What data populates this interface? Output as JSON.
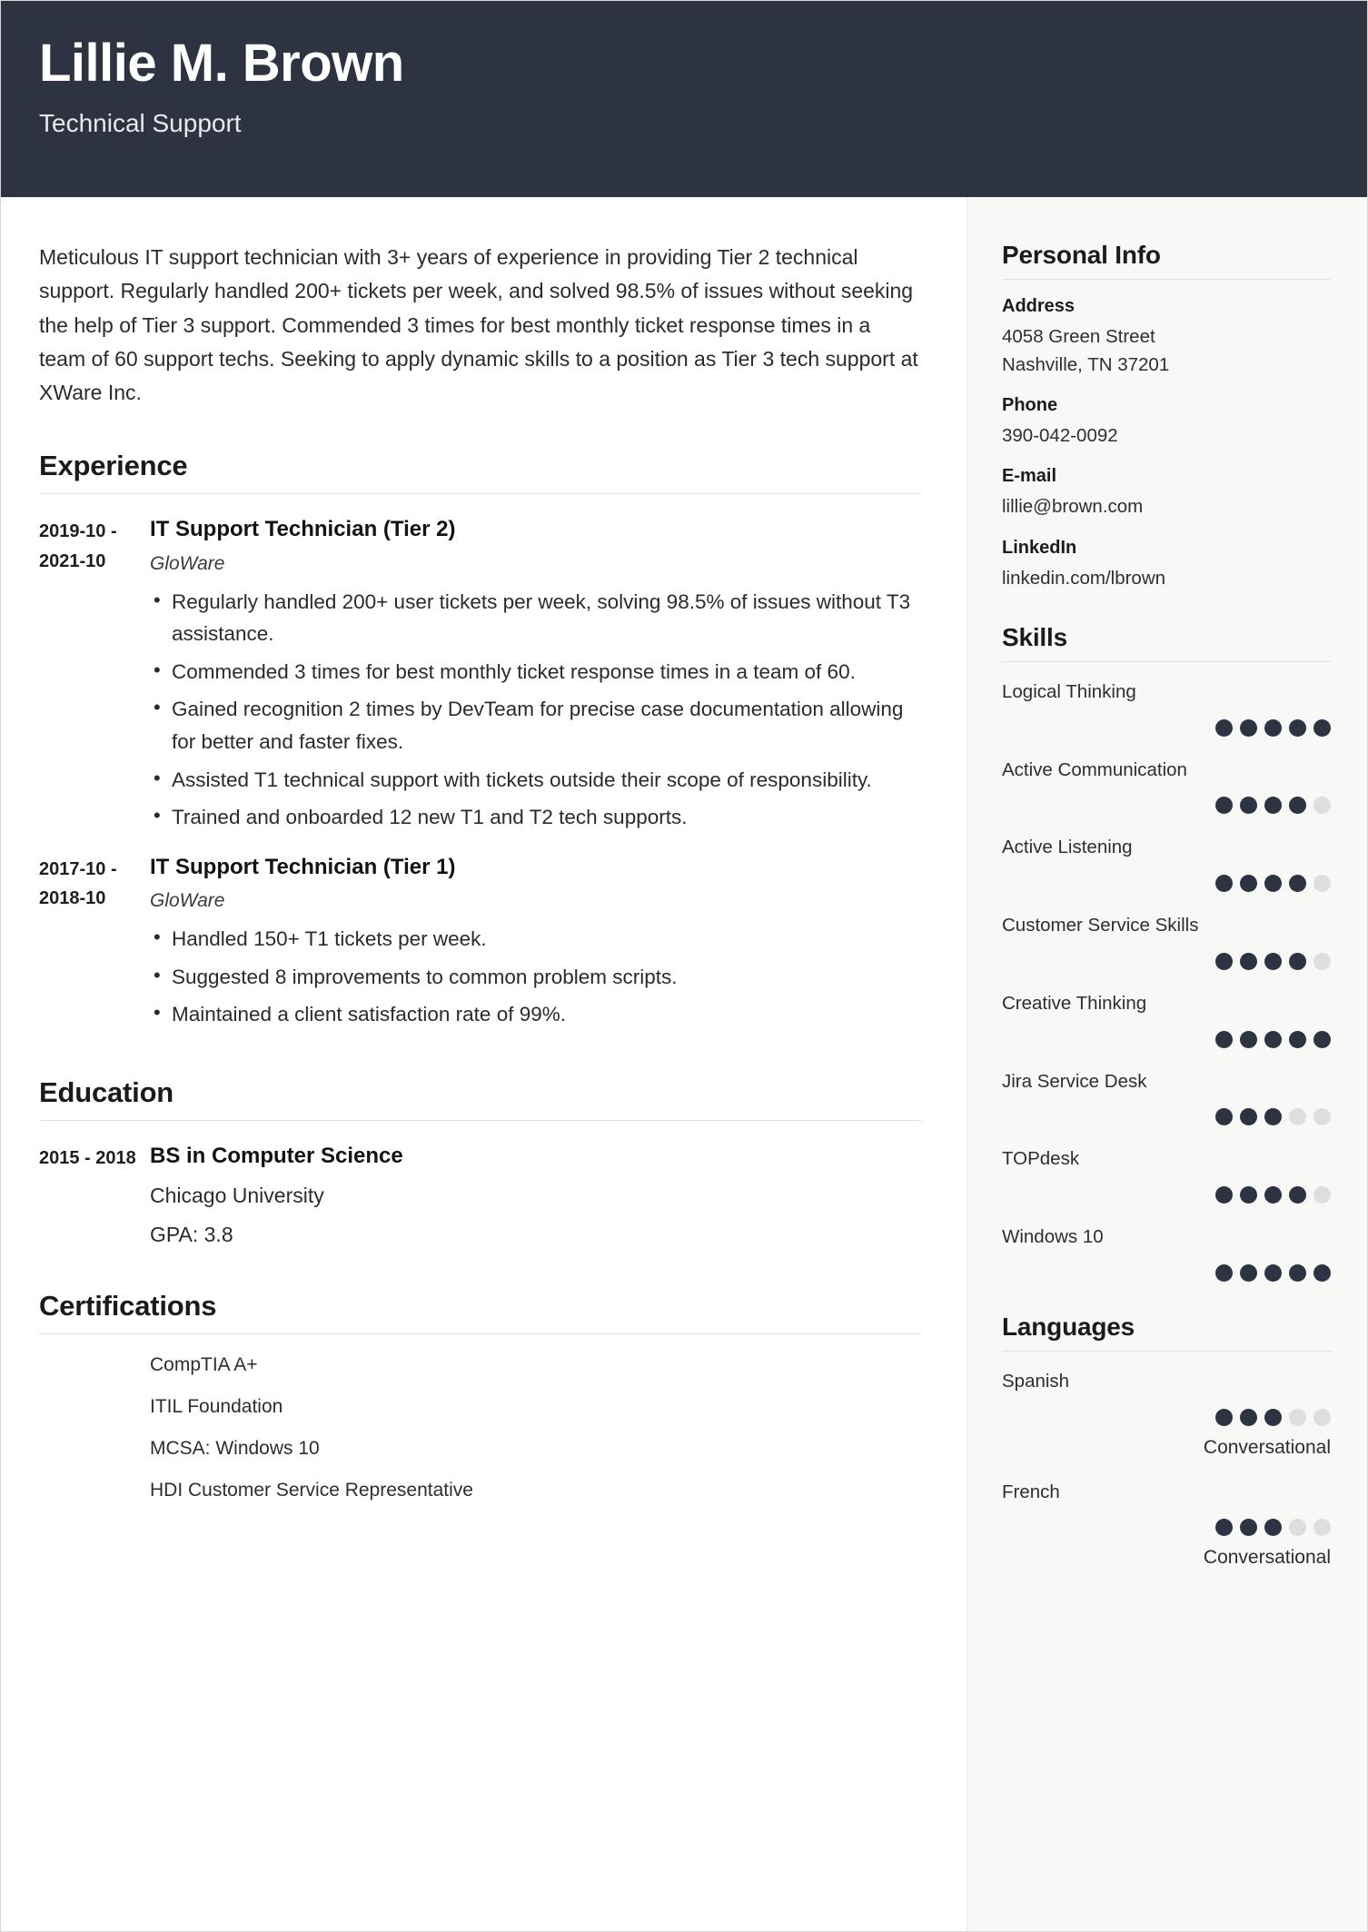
{
  "header": {
    "name": "Lillie M. Brown",
    "job_title": "Technical Support"
  },
  "summary": "Meticulous IT support technician with 3+ years of experience in providing Tier 2 technical support. Regularly handled 200+ tickets per week, and solved 98.5% of issues without seeking the help of Tier 3 support. Commended 3 times for best monthly ticket response times in a team of 60 support techs. Seeking to apply dynamic skills to a position as Tier 3 tech support at XWare Inc.",
  "sections": {
    "experience_title": "Experience",
    "education_title": "Education",
    "certifications_title": "Certifications"
  },
  "experience": [
    {
      "dates": "2019-10 - 2021-10",
      "role": "IT Support Technician (Tier 2)",
      "company": "GloWare",
      "bullets": [
        "Regularly handled 200+ user tickets per week, solving 98.5% of issues without T3 assistance.",
        "Commended 3 times for best monthly ticket response times in a team of 60.",
        "Gained recognition 2 times by DevTeam for precise case documentation allowing for better and faster fixes.",
        "Assisted T1 technical support with tickets outside their scope of responsibility.",
        "Trained and onboarded 12 new T1 and T2 tech supports."
      ]
    },
    {
      "dates": "2017-10 - 2018-10",
      "role": "IT Support Technician (Tier 1)",
      "company": "GloWare",
      "bullets": [
        "Handled 150+ T1 tickets per week.",
        "Suggested 8 improvements to common problem scripts.",
        "Maintained a client satisfaction rate of 99%."
      ]
    }
  ],
  "education": [
    {
      "dates": "2015 - 2018",
      "degree": "BS in Computer Science",
      "school": "Chicago University",
      "gpa": "GPA: 3.8"
    }
  ],
  "certifications": [
    "CompTIA A+",
    "ITIL Foundation",
    "MCSA: Windows 10",
    "HDI Customer Service Representative"
  ],
  "personal_info": {
    "title": "Personal Info",
    "fields": [
      {
        "label": "Address",
        "lines": [
          "4058 Green Street",
          "Nashville, TN 37201"
        ]
      },
      {
        "label": "Phone",
        "lines": [
          "390-042-0092"
        ]
      },
      {
        "label": "E-mail",
        "lines": [
          "lillie@brown.com"
        ]
      },
      {
        "label": "LinkedIn",
        "lines": [
          "linkedin.com/lbrown"
        ]
      }
    ]
  },
  "skills": {
    "title": "Skills",
    "max_rating": 5,
    "items": [
      {
        "name": "Logical Thinking",
        "rating": 5
      },
      {
        "name": "Active Communication",
        "rating": 4
      },
      {
        "name": "Active Listening",
        "rating": 4
      },
      {
        "name": "Customer Service Skills",
        "rating": 4
      },
      {
        "name": "Creative Thinking",
        "rating": 5
      },
      {
        "name": "Jira Service Desk",
        "rating": 3
      },
      {
        "name": "TOPdesk",
        "rating": 4
      },
      {
        "name": "Windows 10",
        "rating": 5
      }
    ]
  },
  "languages": {
    "title": "Languages",
    "max_rating": 5,
    "items": [
      {
        "name": "Spanish",
        "rating": 3,
        "level": "Conversational"
      },
      {
        "name": "French",
        "rating": 3,
        "level": "Conversational"
      }
    ]
  },
  "colors": {
    "header_bg": "#2e3342",
    "sidebar_bg": "#f8f8f7",
    "dot_filled": "#2e3342",
    "dot_empty": "#dedede"
  }
}
